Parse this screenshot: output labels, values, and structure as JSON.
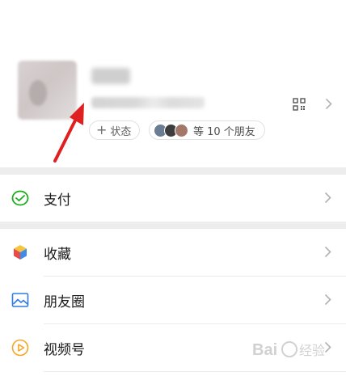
{
  "profile": {
    "status_label": "状态",
    "friends_label": "等 10 个朋友"
  },
  "menu": {
    "pay": "支付",
    "favorites": "收藏",
    "moments": "朋友圈",
    "channels": "视频号"
  },
  "colors": {
    "pay_icon": "#1aad19",
    "moments_icon": "#2f7de1",
    "channels_icon": "#f5a623",
    "arrow": "#e02020",
    "section_gap": "#ededed"
  },
  "watermark_text": "Bai 经验"
}
